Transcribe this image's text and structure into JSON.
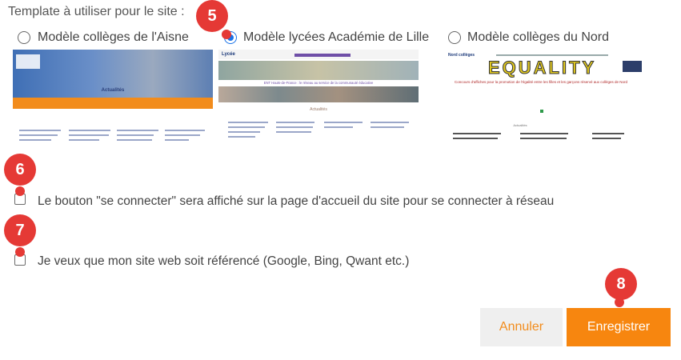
{
  "section_label": "Template à utiliser pour le site :",
  "templates": [
    {
      "label": "Modèle collèges de l'Aisne",
      "selected": false
    },
    {
      "label": "Modèle lycées Académie de Lille",
      "selected": true
    },
    {
      "label": "Modèle collèges du Nord",
      "selected": false
    }
  ],
  "thumbnails": {
    "aisne": {
      "banner_title": "Actualités"
    },
    "lille": {
      "logo": "Lycée",
      "headline": "ENT Hauts-de-France : le réseau au service de la communauté éducative",
      "section": "Actualités"
    },
    "nord": {
      "logo": "Nord collèges",
      "banner_text": "EQUALITY",
      "caption": "Concours d'affiches pour la promotion de l'égalité entre les filles et les garçons réservé aux collèges de Nord",
      "section": "Actualités"
    }
  },
  "options": {
    "connect_button": {
      "label": "Le bouton \"se connecter\" sera affiché sur la page d'accueil du site pour se connecter à réseau",
      "checked": false
    },
    "seo": {
      "label": "Je veux que mon site web soit référencé (Google, Bing, Qwant etc.)",
      "checked": false
    }
  },
  "markers": [
    "5",
    "6",
    "7",
    "8"
  ],
  "buttons": {
    "cancel": "Annuler",
    "save": "Enregistrer"
  },
  "colors": {
    "accent": "#1a73e8",
    "save": "#f7860f",
    "marker": "#e53935"
  }
}
